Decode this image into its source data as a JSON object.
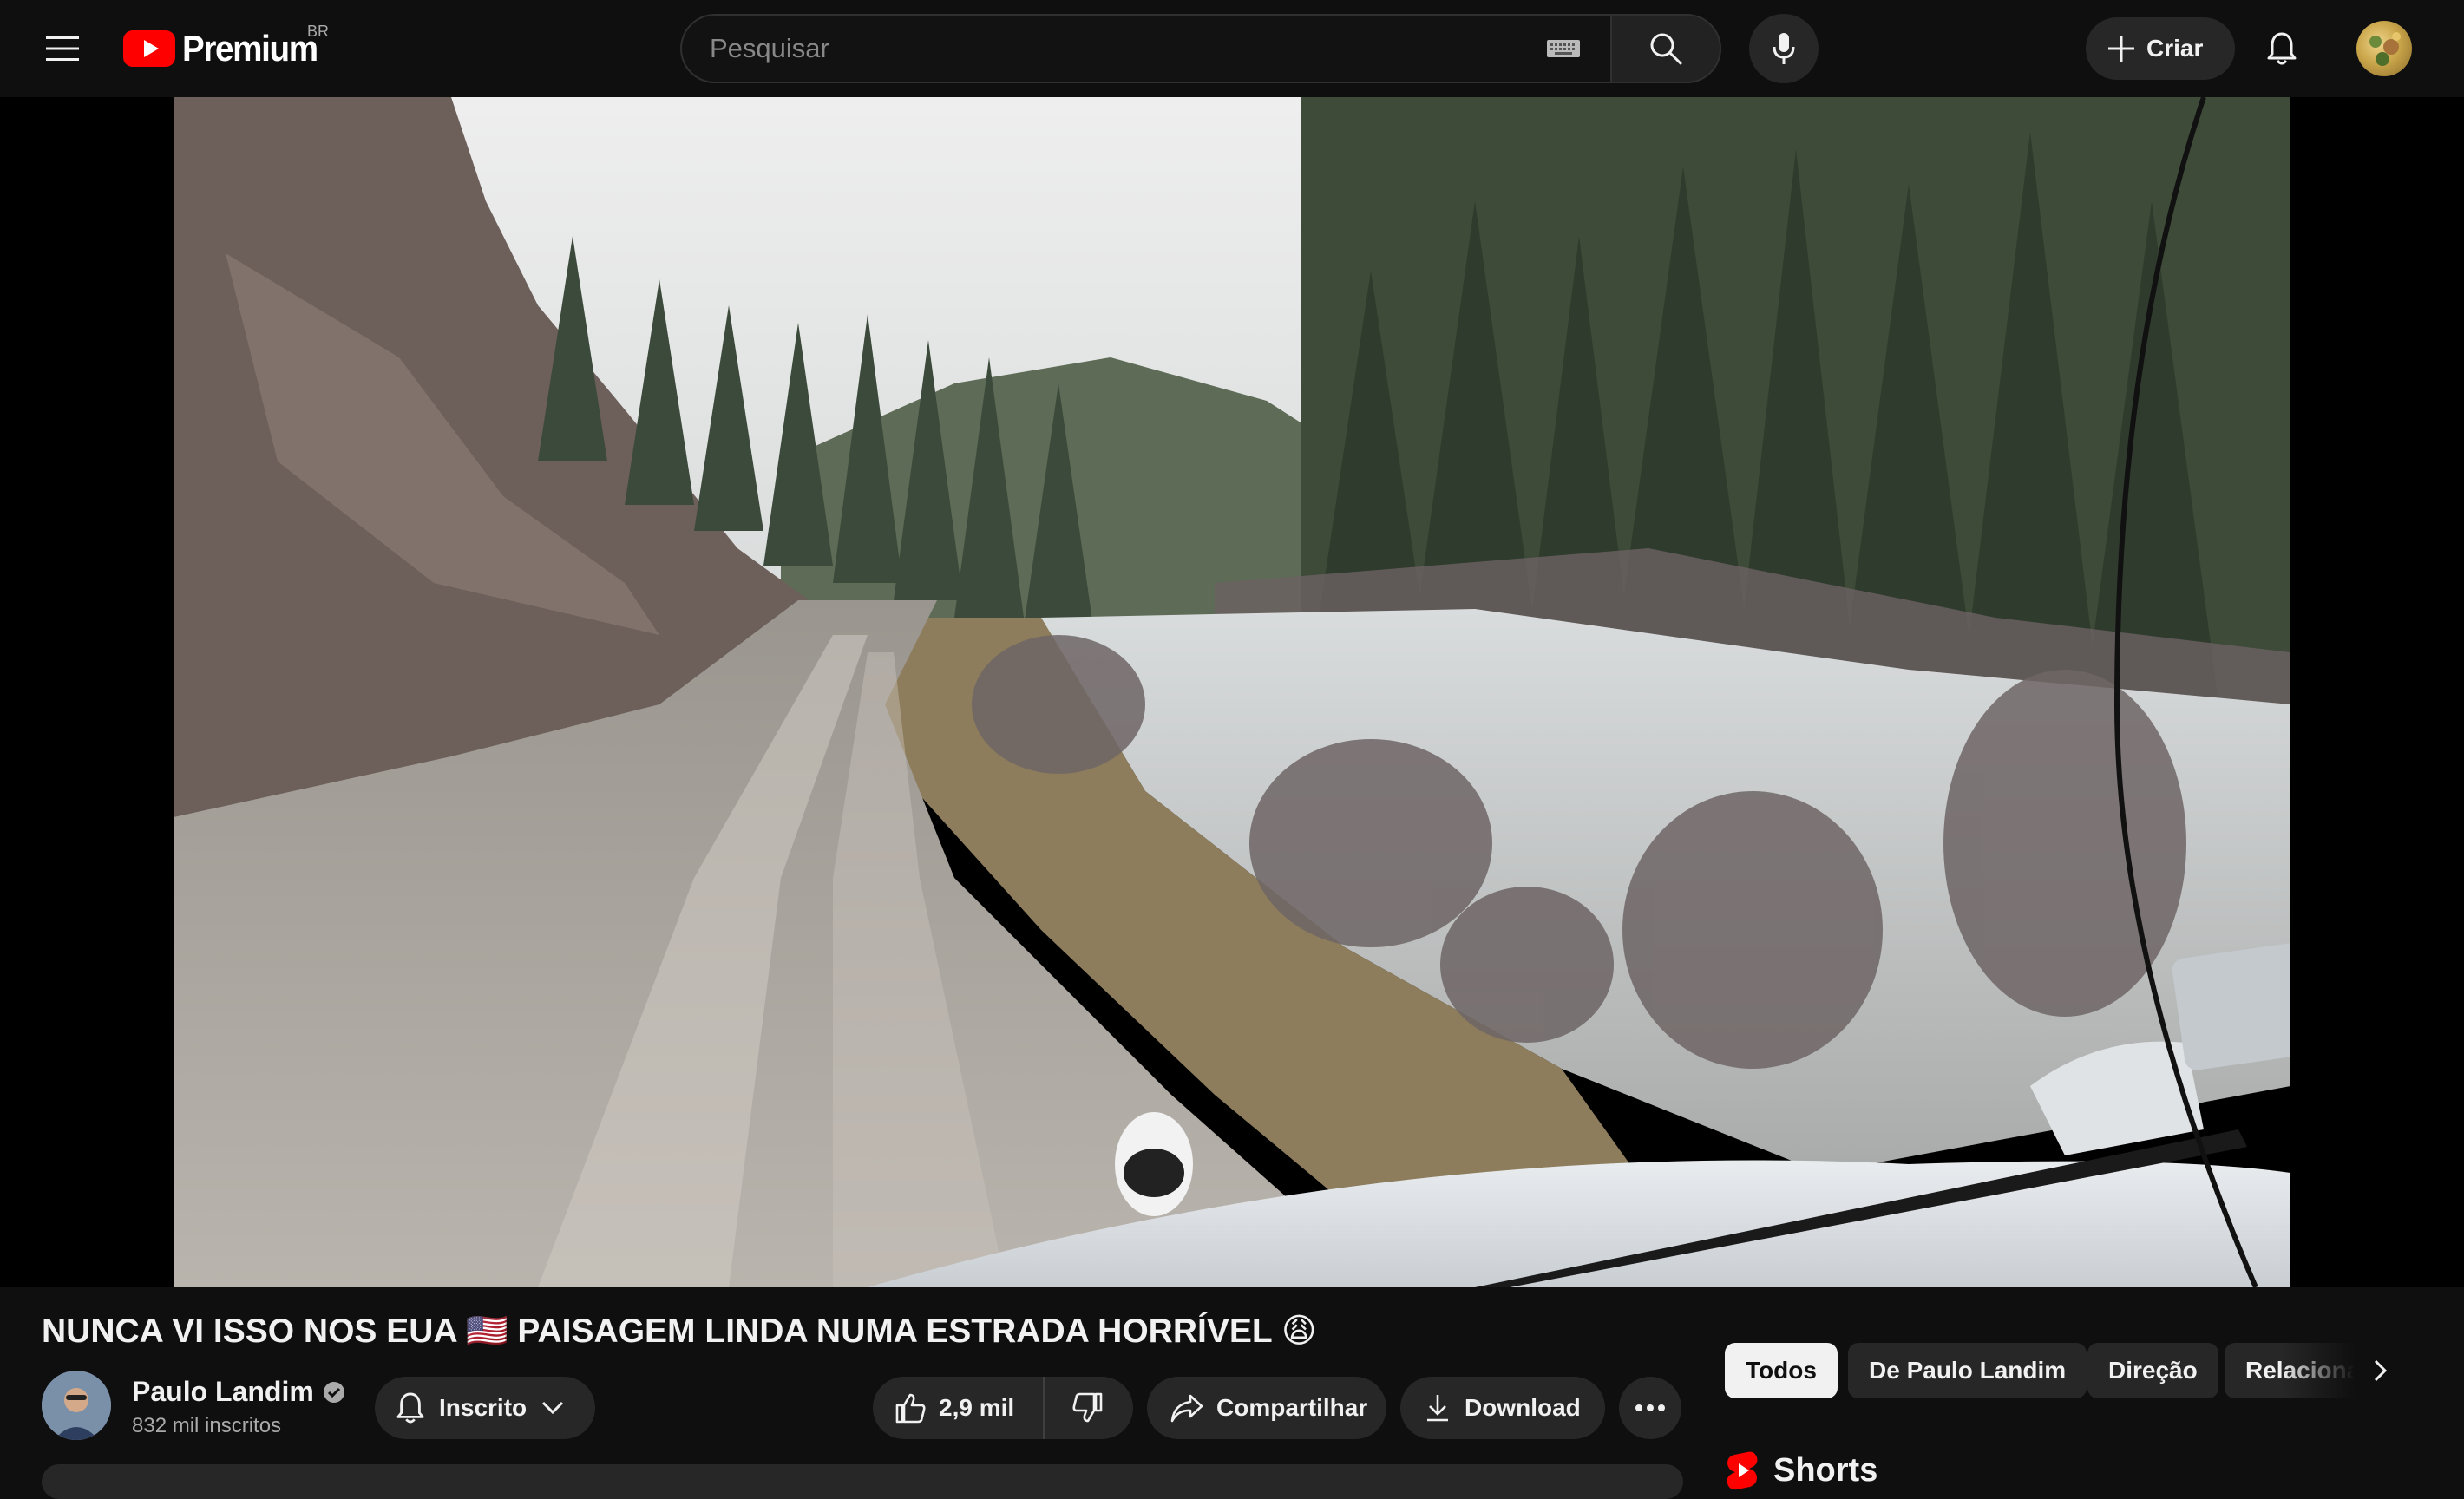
{
  "masthead": {
    "logo_text": "Premium",
    "region": "BR",
    "search_placeholder": "Pesquisar",
    "create_label": "Criar",
    "icons": [
      "menu-icon",
      "youtube-logo-icon",
      "keyboard-icon",
      "search-icon",
      "mic-icon",
      "plus-icon",
      "bell-icon"
    ]
  },
  "video": {
    "title": "NUNCA VI ISSO NOS EUA 🇺🇸 PAISAGEM LINDA NUMA ESTRADA HORRÍVEL 😩",
    "description": "Vista de dentro do carro: estrada de terra molhada ao lado de um rio, com floresta de pinheiros e encostas rochosas."
  },
  "channel": {
    "name": "Paulo Landim",
    "subscribers": "832 mil inscritos",
    "verified": true
  },
  "actions": {
    "subscribed_label": "Inscrito",
    "like_count": "2,9 mil",
    "share_label": "Compartilhar",
    "download_label": "Download"
  },
  "sidebar": {
    "chips": [
      "Todos",
      "De Paulo Landim",
      "Direção",
      "Relacionados"
    ],
    "active_chip": "Todos",
    "shelf_title": "Shorts"
  },
  "colors": {
    "background": "#0f0f0f",
    "youtube_red": "#ff0000",
    "pill": "#272727",
    "text": "#f1f1f1",
    "secondary_text": "#aaaaaa"
  }
}
